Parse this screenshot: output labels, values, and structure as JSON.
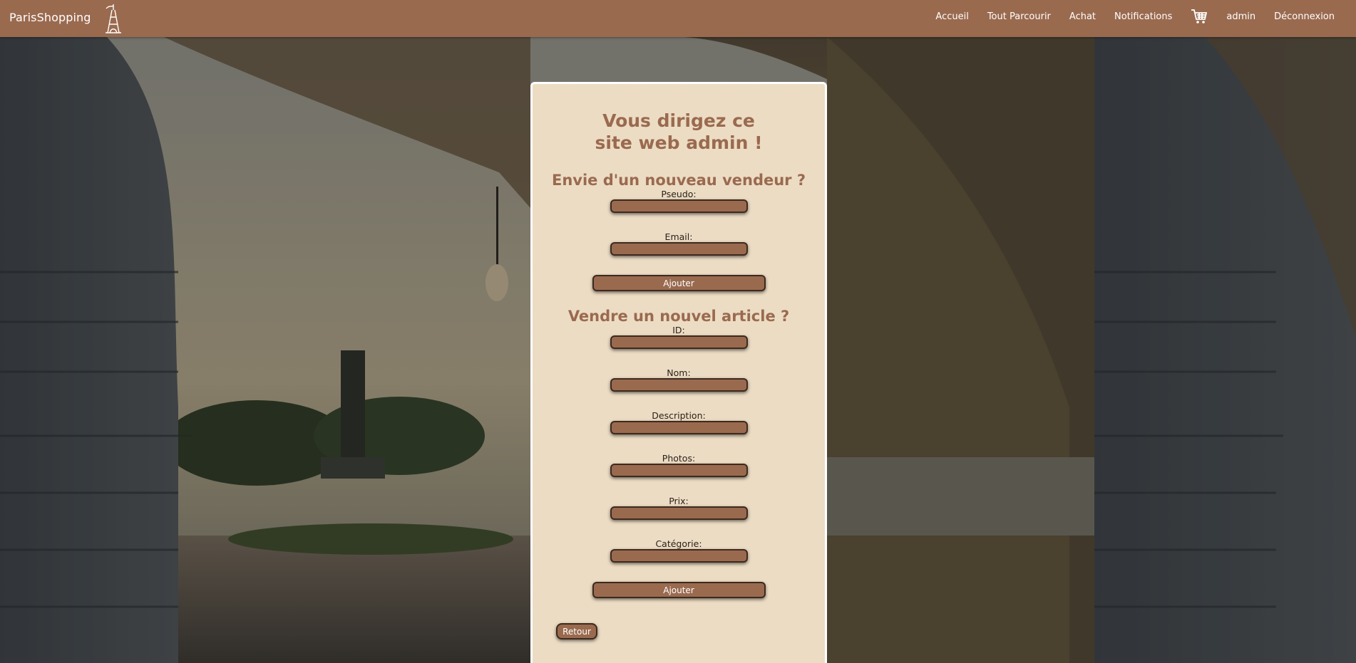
{
  "navbar": {
    "brand": "ParisShopping",
    "links": [
      "Accueil",
      "Tout Parcourir",
      "Achat",
      "Notifications"
    ],
    "cart_icon": "cart-icon",
    "user": "admin",
    "logout": "Déconnexion"
  },
  "card": {
    "title": "Vous dirigez ce site web admin !",
    "vendor_section": {
      "heading": "Envie d'un nouveau vendeur ?",
      "fields": [
        {
          "label": "Pseudo:",
          "value": ""
        },
        {
          "label": "Email:",
          "value": ""
        }
      ],
      "submit_label": "Ajouter"
    },
    "article_section": {
      "heading": "Vendre un nouvel article ?",
      "fields": [
        {
          "label": "ID:",
          "value": ""
        },
        {
          "label": "Nom:",
          "value": ""
        },
        {
          "label": "Description:",
          "value": ""
        },
        {
          "label": "Photos:",
          "value": ""
        },
        {
          "label": "Prix:",
          "value": ""
        },
        {
          "label": "Catégorie:",
          "value": ""
        }
      ],
      "submit_label": "Ajouter"
    },
    "back_label": "Retour"
  },
  "colors": {
    "accent": "#9a6a4f",
    "card_background": "#ecdcc4",
    "heading_text": "#9a6a4f"
  }
}
